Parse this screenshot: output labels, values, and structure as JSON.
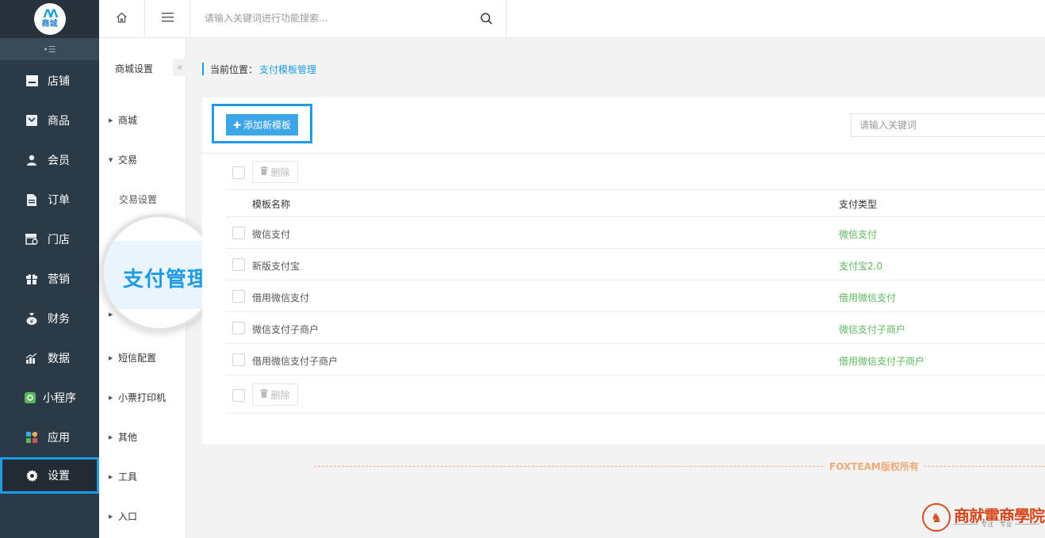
{
  "logo": {
    "brand_text": "商城"
  },
  "sidebar": {
    "collapse_icon": "collapse-icon",
    "items": [
      {
        "label": "店铺",
        "icon": "store-icon"
      },
      {
        "label": "商品",
        "icon": "goods-icon"
      },
      {
        "label": "会员",
        "icon": "user-icon"
      },
      {
        "label": "订单",
        "icon": "order-icon"
      },
      {
        "label": "门店",
        "icon": "shop-icon"
      },
      {
        "label": "营销",
        "icon": "gift-icon"
      },
      {
        "label": "财务",
        "icon": "money-bag-icon"
      },
      {
        "label": "数据",
        "icon": "chart-icon"
      },
      {
        "label": "小程序",
        "icon": "miniprogram-icon"
      },
      {
        "label": "应用",
        "icon": "apps-icon"
      },
      {
        "label": "设置",
        "icon": "gear-icon",
        "active": true
      }
    ]
  },
  "topbar": {
    "home_icon": "home-icon",
    "menu_icon": "menu-icon",
    "search_placeholder": "请输入关键词进行功能搜索...",
    "search_icon": "search-icon"
  },
  "submenu": {
    "title": "商城设置",
    "toggle": "«",
    "items": [
      {
        "label": "商城",
        "expanded": false
      },
      {
        "label": "交易",
        "expanded": true
      },
      {
        "label": "交易设置",
        "child": true
      },
      {
        "label": "短信配置",
        "expanded": false
      },
      {
        "label": "小票打印机",
        "expanded": false
      },
      {
        "label": "其他",
        "expanded": false
      },
      {
        "label": "工具",
        "expanded": false
      },
      {
        "label": "入口",
        "expanded": false
      }
    ],
    "magnifier_text": "支付管理"
  },
  "breadcrumb": {
    "prefix": "当前位置：",
    "current": "支付模板管理"
  },
  "toolbar": {
    "add_label": "添加新模板",
    "keyword_placeholder": "请输入关键词",
    "delete_label": "删除"
  },
  "table": {
    "headers": [
      "模板名称",
      "支付类型"
    ],
    "rows": [
      {
        "name": "微信支付",
        "type": "微信支付"
      },
      {
        "name": "新版支付宝",
        "type": "支付宝2.0"
      },
      {
        "name": "借用微信支付",
        "type": "借用微信支付"
      },
      {
        "name": "微信支付子商户",
        "type": "微信支付子商户"
      },
      {
        "name": "借用微信支付子商户",
        "type": "借用微信支付子商户"
      }
    ]
  },
  "footer": {
    "copyright": "FOXTEAM版权所有"
  },
  "watermark": {
    "name": "商就電商學院",
    "slogan": "专注 · 专业"
  },
  "colors": {
    "accent": "#1e9be8",
    "sidebar_bg": "#2b3a47",
    "green": "#5cb85c",
    "footer": "#f0a878"
  }
}
